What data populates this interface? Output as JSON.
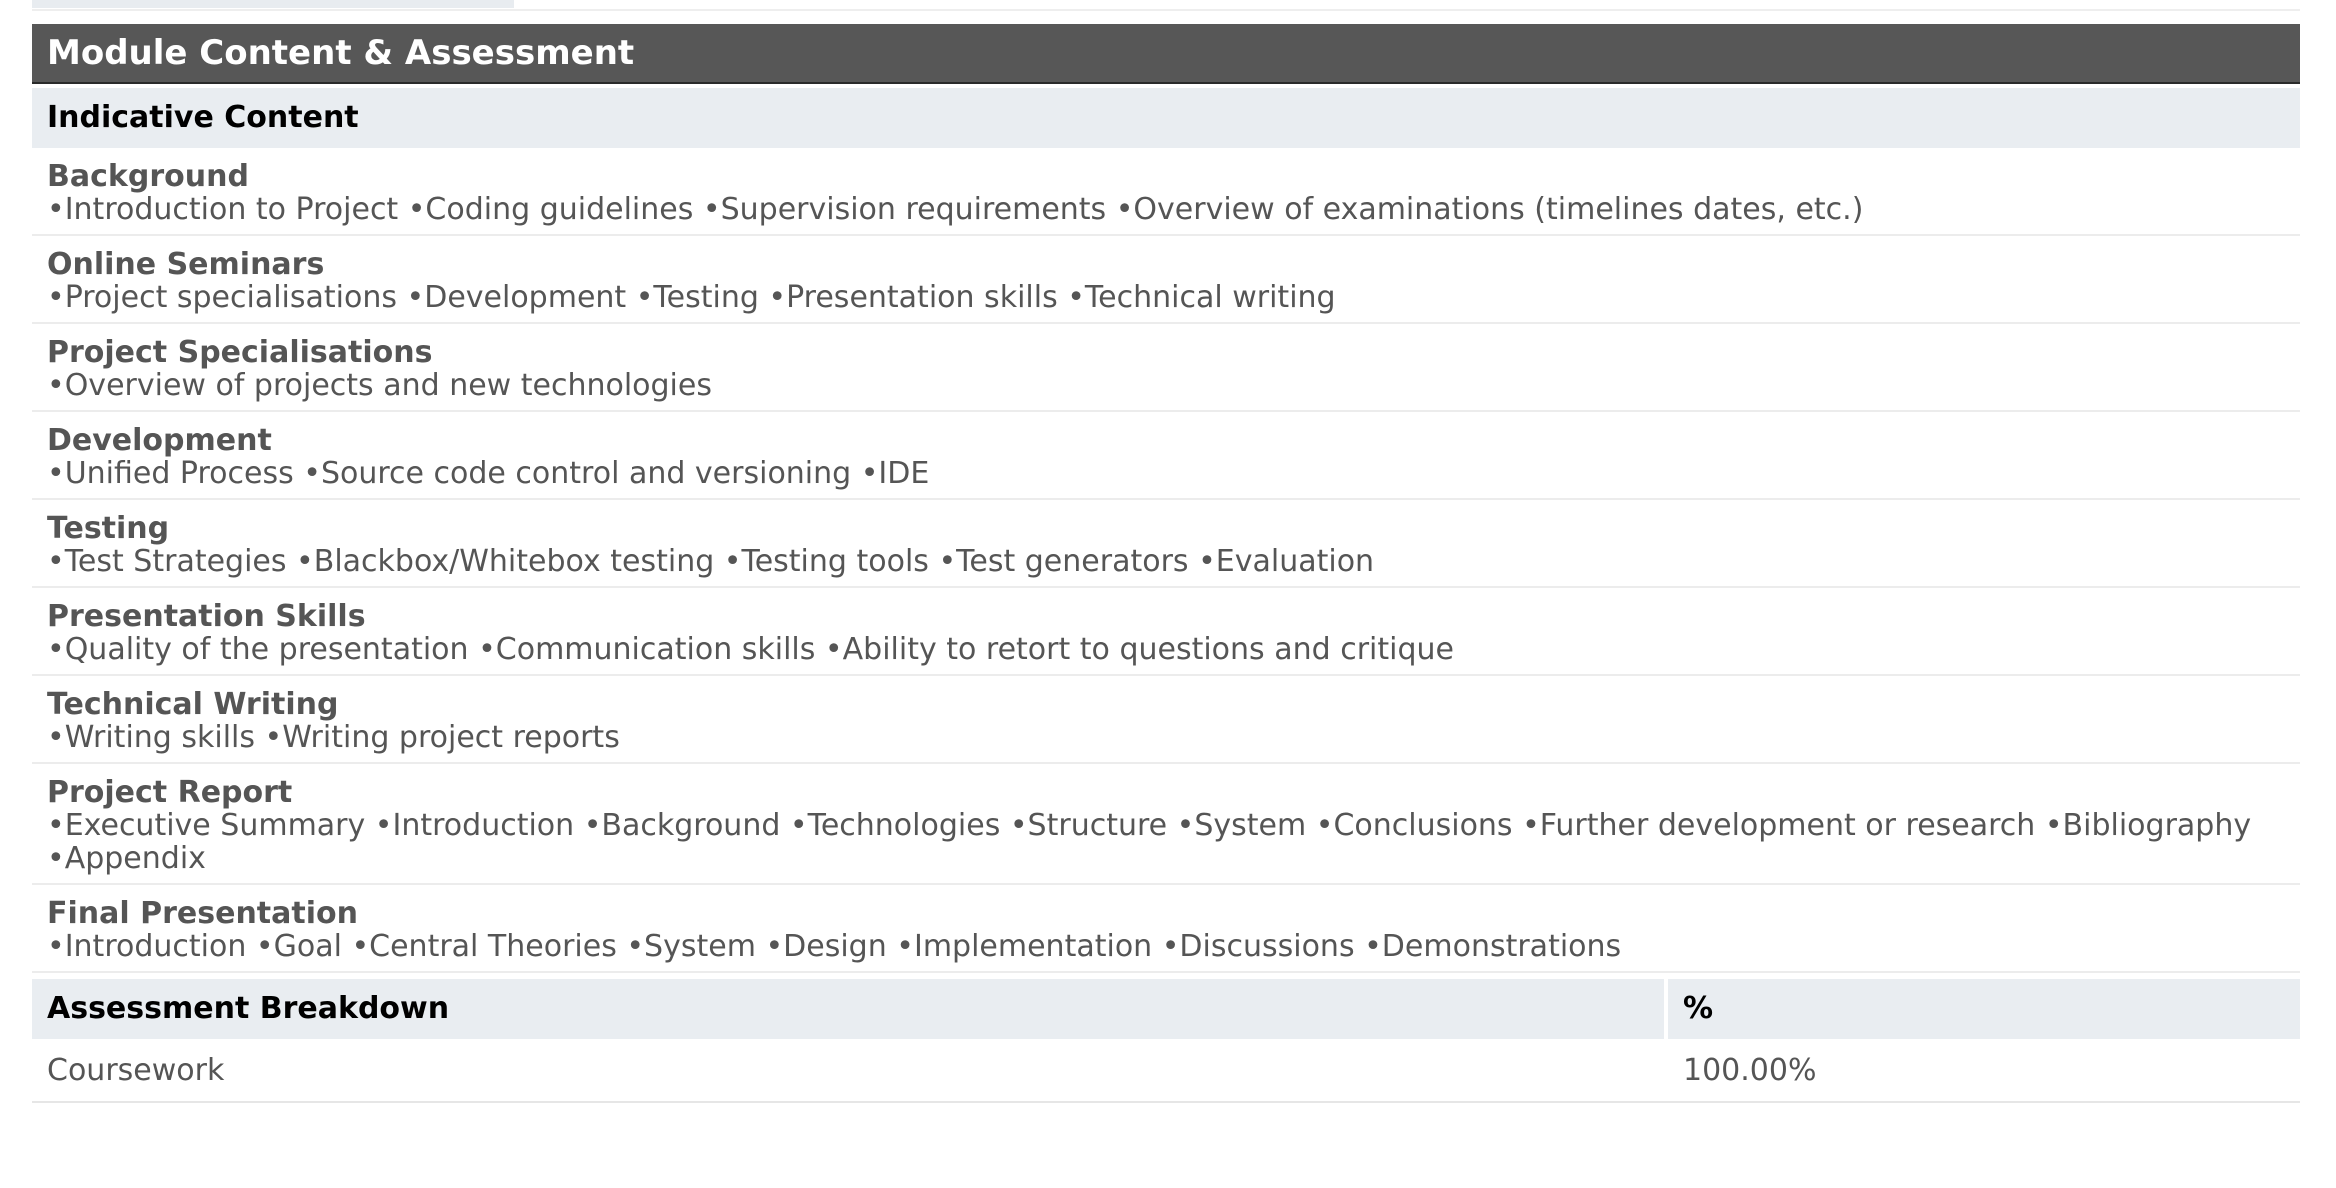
{
  "module": {
    "section_title": "Module Content & Assessment",
    "indicative_title": "Indicative Content",
    "items": [
      {
        "title": "Background",
        "body": "•Introduction to Project •Coding guidelines •Supervision requirements •Overview of examinations (timelines dates, etc.)"
      },
      {
        "title": "Online Seminars",
        "body": "•Project specialisations •Development •Testing •Presentation skills •Technical writing"
      },
      {
        "title": "Project Specialisations",
        "body": "•Overview of projects and new technologies"
      },
      {
        "title": "Development",
        "body": "•Unified Process •Source code control and versioning •IDE"
      },
      {
        "title": "Testing",
        "body": "•Test Strategies •Blackbox/Whitebox testing •Testing tools •Test generators •Evaluation"
      },
      {
        "title": "Presentation Skills",
        "body": "•Quality of the presentation •Communication skills •Ability to retort to questions and critique"
      },
      {
        "title": "Technical Writing",
        "body": "•Writing skills •Writing project reports"
      },
      {
        "title": "Project Report",
        "body": "•Executive Summary •Introduction •Background •Technologies •Structure •System •Conclusions •Further development or research •Bibliography •Appendix"
      },
      {
        "title": "Final Presentation",
        "body": "•Introduction •Goal •Central Theories •System •Design •Implementation •Discussions •Demonstrations"
      }
    ]
  },
  "assessment": {
    "header_label": "Assessment Breakdown",
    "header_percent": "%",
    "rows": [
      {
        "label": "Coursework",
        "percent": "100.00%"
      }
    ]
  },
  "colors": {
    "header_bg": "#575757",
    "subheader_bg": "#e9edf1",
    "text": "#555555"
  }
}
